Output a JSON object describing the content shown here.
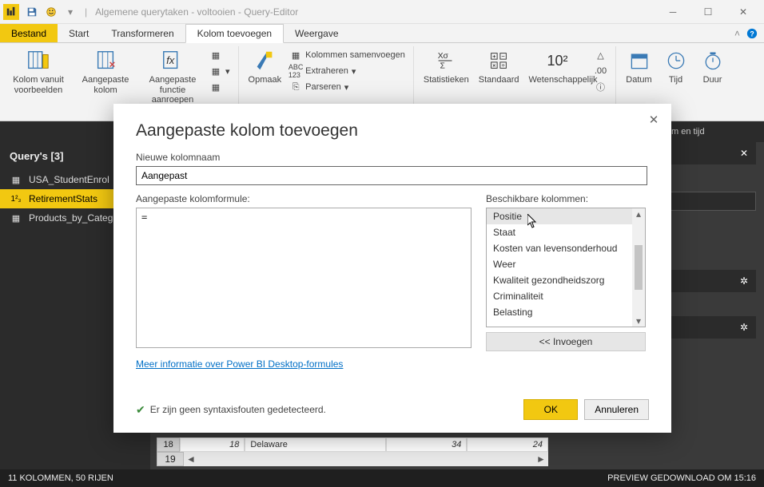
{
  "title": "Algemene querytaken - voltooien - Query-Editor",
  "menutabs": {
    "file": "Bestand",
    "start": "Start",
    "transform": "Transformeren",
    "addcol": "Kolom toevoegen",
    "view": "Weergave"
  },
  "ribbon": {
    "fromExamples": "Kolom vanuit voorbeelden",
    "customCol": "Aangepaste kolom",
    "customFn": "Aangepaste functie aanroepen",
    "format": "Opmaak",
    "merge": "Kolommen samenvoegen",
    "extract": "Extraheren",
    "parse": "Parseren",
    "stats": "Statistieken",
    "standard": "Standaard",
    "scientific": "Wetenschappelijk",
    "tenx": "10²",
    "date": "Datum",
    "time": "Tijd",
    "duration": "Duur"
  },
  "darkbar_frag": "m en tijd",
  "queries_hdr": "Query's [3]",
  "queries": [
    "USA_StudentEnrol",
    "RetirementStats",
    "Products_by_Categ"
  ],
  "gridrow": {
    "n": "18",
    "c1": "18",
    "c2": "Delaware",
    "c3": "34",
    "c4": "24",
    "n2": "19"
  },
  "status_left": "11 KOLOMMEN, 50 RIJEN",
  "status_right": "PREVIEW GEDOWNLOAD OM 15:16",
  "dialog": {
    "title": "Aangepaste kolom toevoegen",
    "new_col_label": "Nieuwe kolomnaam",
    "new_col_value": "Aangepast",
    "formula_label": "Aangepaste kolomformule:",
    "formula_value": "=",
    "avail_label": "Beschikbare kolommen:",
    "avail": [
      "Positie",
      "Staat",
      "Kosten van levensonderhoud",
      "Weer",
      "Kwaliteit gezondheidszorg",
      "Criminaliteit",
      "Belasting"
    ],
    "insert": "<< Invoegen",
    "link": "Meer informatie over Power BI Desktop-formules",
    "status": "Er zijn geen syntaxisfouten gedetecteerd.",
    "ok": "OK",
    "cancel": "Annuleren"
  }
}
